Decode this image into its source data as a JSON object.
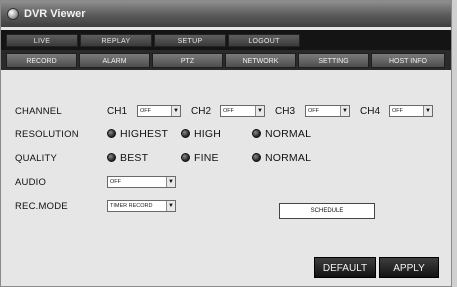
{
  "window": {
    "title": "DVR Viewer"
  },
  "main_tabs": [
    {
      "label": "LIVE"
    },
    {
      "label": "REPLAY"
    },
    {
      "label": "SETUP"
    },
    {
      "label": "LOGOUT"
    }
  ],
  "sub_tabs": [
    {
      "label": "RECORD"
    },
    {
      "label": "ALARM"
    },
    {
      "label": "PTZ"
    },
    {
      "label": "NETWORK"
    },
    {
      "label": "SETTING"
    },
    {
      "label": "HOST INFO"
    }
  ],
  "record": {
    "channel_label": "CHANNEL",
    "channels": [
      {
        "name": "CH1",
        "value": "OFF"
      },
      {
        "name": "CH2",
        "value": "OFF"
      },
      {
        "name": "CH3",
        "value": "OFF"
      },
      {
        "name": "CH4",
        "value": "OFF"
      }
    ],
    "resolution_label": "RESOLUTION",
    "resolution_options": [
      "HIGHEST",
      "HIGH",
      "NORMAL"
    ],
    "quality_label": "QUALITY",
    "quality_options": [
      "BEST",
      "FINE",
      "NORMAL"
    ],
    "audio_label": "AUDIO",
    "audio_value": "OFF",
    "rec_mode_label": "REC.MODE",
    "rec_mode_value": "TIMER RECORD",
    "schedule_label": "SCHEDULE",
    "default_label": "DEFAULT",
    "apply_label": "APPLY"
  },
  "icons": {
    "app": "dvr-app-icon",
    "dropdown": "chevron-down-icon"
  }
}
